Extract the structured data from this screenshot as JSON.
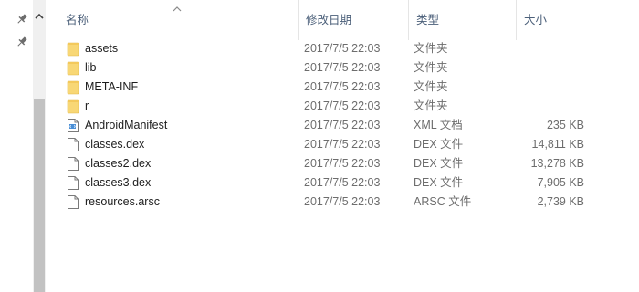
{
  "header": {
    "name": "名称",
    "date": "修改日期",
    "type": "类型",
    "size": "大小"
  },
  "files": [
    {
      "name": "assets",
      "date": "2017/7/5 22:03",
      "type": "文件夹",
      "size": "",
      "icon": "folder-icon"
    },
    {
      "name": "lib",
      "date": "2017/7/5 22:03",
      "type": "文件夹",
      "size": "",
      "icon": "folder-icon"
    },
    {
      "name": "META-INF",
      "date": "2017/7/5 22:03",
      "type": "文件夹",
      "size": "",
      "icon": "folder-icon"
    },
    {
      "name": "r",
      "date": "2017/7/5 22:03",
      "type": "文件夹",
      "size": "",
      "icon": "folder-icon"
    },
    {
      "name": "AndroidManifest",
      "date": "2017/7/5 22:03",
      "type": "XML 文档",
      "size": "235 KB",
      "icon": "xml-file-icon"
    },
    {
      "name": "classes.dex",
      "date": "2017/7/5 22:03",
      "type": "DEX 文件",
      "size": "14,811 KB",
      "icon": "file-icon"
    },
    {
      "name": "classes2.dex",
      "date": "2017/7/5 22:03",
      "type": "DEX 文件",
      "size": "13,278 KB",
      "icon": "file-icon"
    },
    {
      "name": "classes3.dex",
      "date": "2017/7/5 22:03",
      "type": "DEX 文件",
      "size": "7,905 KB",
      "icon": "file-icon"
    },
    {
      "name": "resources.arsc",
      "date": "2017/7/5 22:03",
      "type": "ARSC 文件",
      "size": "2,739 KB",
      "icon": "file-icon"
    }
  ],
  "colors": {
    "folder": "#f8d775",
    "header_text": "#4c607a",
    "scroll_thumb": "#c2c2c2"
  }
}
